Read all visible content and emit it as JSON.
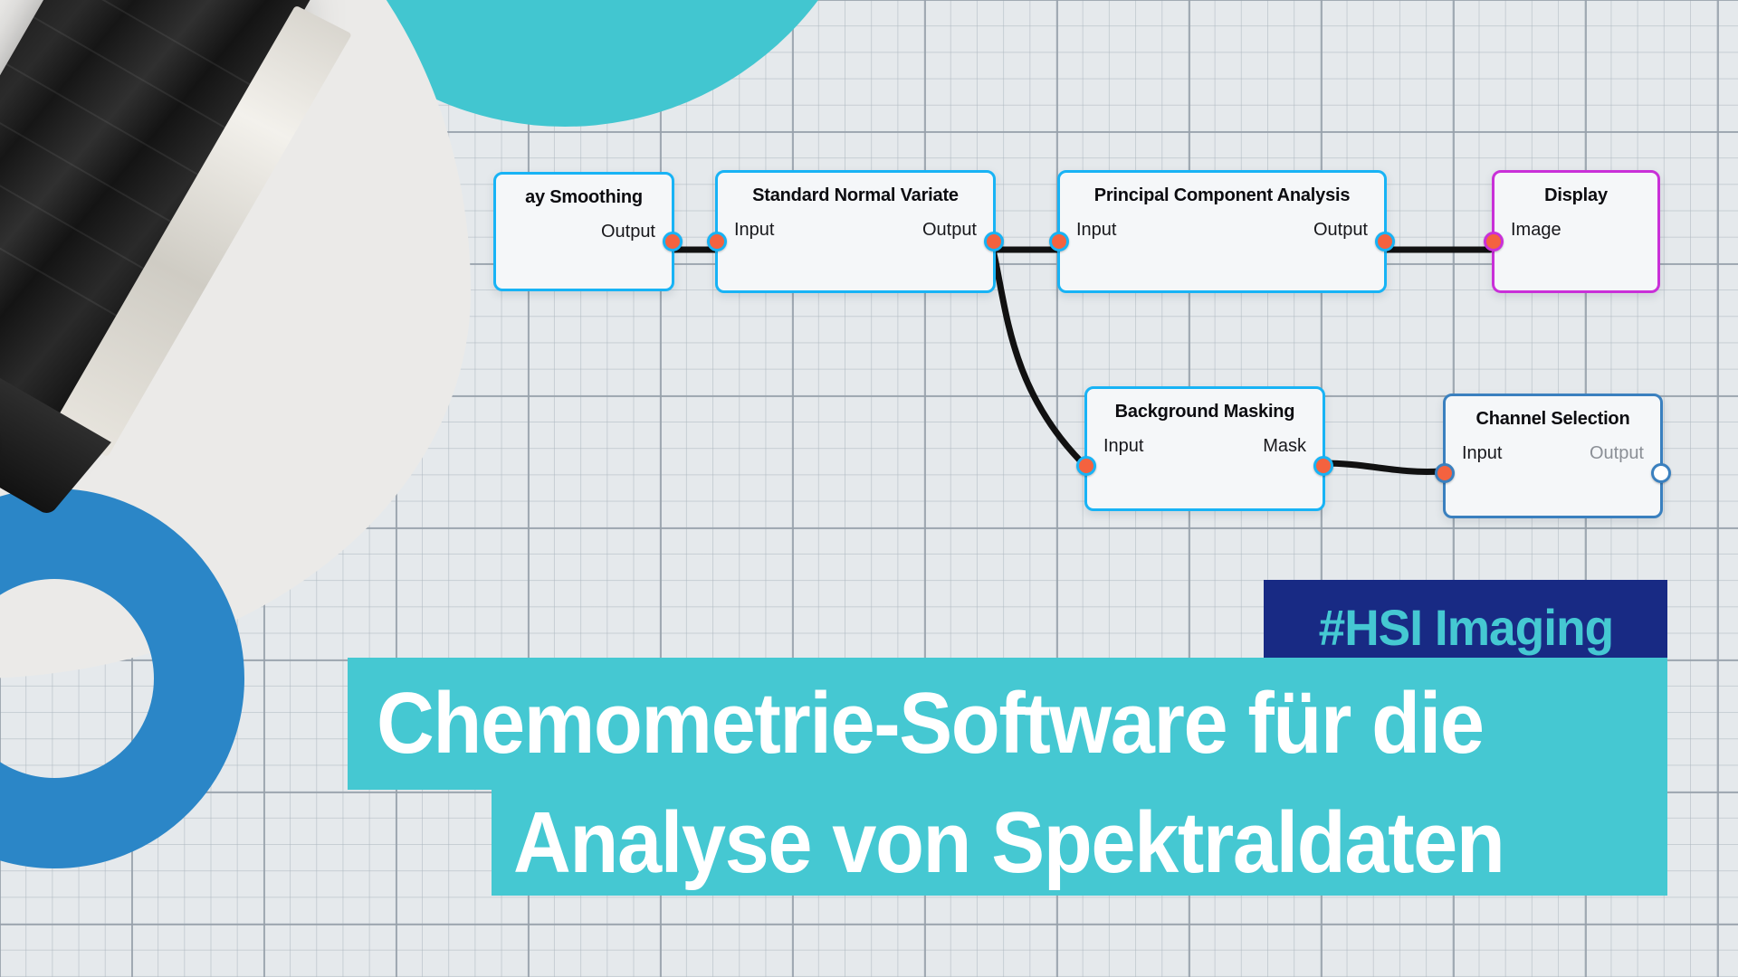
{
  "background": {
    "grid": "graph-paper",
    "base_color": "#e5e9ec",
    "blob_gray_color": "#ebeae8",
    "blob_teal_color": "#42c6d0",
    "ring_blue_color": "#2b86c7"
  },
  "photo": {
    "subject": "hyperspectral-camera",
    "accent_stripe_color": "#f07818"
  },
  "graph": {
    "nodes": [
      {
        "id": "savitzky-golay-smoothing",
        "title": "...ay Smoothing",
        "ports": [
          {
            "name": "Output",
            "side": "right",
            "state": "connected"
          }
        ],
        "accent": "#18b3f5"
      },
      {
        "id": "standard-normal-variate",
        "title": "Standard Normal Variate",
        "ports": [
          {
            "name": "Input",
            "side": "left",
            "state": "connected"
          },
          {
            "name": "Output",
            "side": "right",
            "state": "connected"
          }
        ],
        "accent": "#18b3f5"
      },
      {
        "id": "principal-component-analysis",
        "title": "Principal Component Analysis",
        "ports": [
          {
            "name": "Input",
            "side": "left",
            "state": "connected"
          },
          {
            "name": "Output",
            "side": "right",
            "state": "connected"
          }
        ],
        "accent": "#18b3f5"
      },
      {
        "id": "display",
        "title": "Display",
        "ports": [
          {
            "name": "Image",
            "side": "left",
            "state": "connected"
          }
        ],
        "accent": "#c930d8"
      },
      {
        "id": "background-masking",
        "title": "Background Masking",
        "ports": [
          {
            "name": "Input",
            "side": "left",
            "state": "connected"
          },
          {
            "name": "Mask",
            "side": "right",
            "state": "connected"
          }
        ],
        "accent": "#18b3f5"
      },
      {
        "id": "channel-selection",
        "title": "Channel Selection",
        "ports": [
          {
            "name": "Input",
            "side": "left",
            "state": "connected"
          },
          {
            "name": "Output",
            "side": "right",
            "state": "empty"
          }
        ],
        "accent": "#3a80bf"
      }
    ],
    "node_labels": {
      "savgol_title": "ay Smoothing",
      "savgol_output": "Output",
      "snv_title": "Standard Normal Variate",
      "snv_input": "Input",
      "snv_output": "Output",
      "pca_title": "Principal Component Analysis",
      "pca_input": "Input",
      "pca_output": "Output",
      "display_title": "Display",
      "display_image": "Image",
      "bgmask_title": "Background Masking",
      "bgmask_input": "Input",
      "bgmask_mask": "Mask",
      "chansel_title": "Channel Selection",
      "chansel_input": "Input",
      "chansel_output": "Output"
    },
    "connections": [
      {
        "from": "savitzky-golay-smoothing.Output",
        "to": "standard-normal-variate.Input"
      },
      {
        "from": "standard-normal-variate.Output",
        "to": "principal-component-analysis.Input"
      },
      {
        "from": "standard-normal-variate.Output",
        "to": "background-masking.Input"
      },
      {
        "from": "principal-component-analysis.Output",
        "to": "display.Image"
      },
      {
        "from": "background-masking.Mask",
        "to": "channel-selection.Input"
      }
    ]
  },
  "promo": {
    "badge": "#HSI Imaging",
    "badge_bg": "#182a84",
    "badge_fg": "#45c8d2",
    "headline_line1": "Chemometrie-Software für die",
    "headline_line2": "Analyse von Spektraldaten",
    "band_bg": "#45c8d2",
    "band_fg": "#ffffff"
  }
}
